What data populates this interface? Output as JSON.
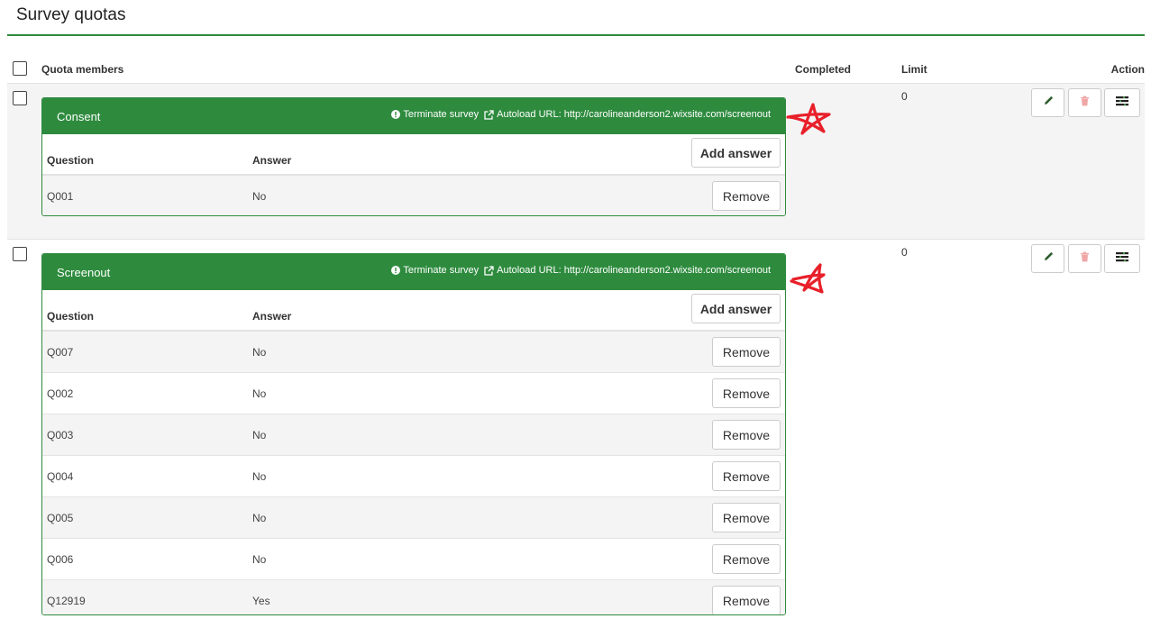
{
  "page": {
    "title": "Survey quotas"
  },
  "table_headers": {
    "members": "Quota members",
    "completed": "Completed",
    "limit": "Limit",
    "action": "Action"
  },
  "colors": {
    "accent": "#2e8b3e",
    "annotation": "#e8202a"
  },
  "icons": {
    "edit": "pencil-icon",
    "delete": "trash-icon",
    "details": "list-icon",
    "action": "exclamation-circle-icon",
    "link": "external-link-icon"
  },
  "quotas": [
    {
      "name": "Consent",
      "action_text": "Terminate survey",
      "autoload_text": "Autoload URL: http://carolineanderson2.wixsite.com/screenout",
      "limit": "0",
      "question_header": "Question",
      "answer_header": "Answer",
      "add_answer_label": "Add answer",
      "members": [
        {
          "question": "Q001",
          "answer": "No",
          "remove_label": "Remove"
        }
      ]
    },
    {
      "name": "Screenout",
      "action_text": "Terminate survey",
      "autoload_text": "Autoload URL: http://carolineanderson2.wixsite.com/screenout",
      "limit": "0",
      "question_header": "Question",
      "answer_header": "Answer",
      "add_answer_label": "Add answer",
      "members": [
        {
          "question": "Q007",
          "answer": "No",
          "remove_label": "Remove"
        },
        {
          "question": "Q002",
          "answer": "No",
          "remove_label": "Remove"
        },
        {
          "question": "Q003",
          "answer": "No",
          "remove_label": "Remove"
        },
        {
          "question": "Q004",
          "answer": "No",
          "remove_label": "Remove"
        },
        {
          "question": "Q005",
          "answer": "No",
          "remove_label": "Remove"
        },
        {
          "question": "Q006",
          "answer": "No",
          "remove_label": "Remove"
        },
        {
          "question": "Q12919",
          "answer": "Yes",
          "remove_label": "Remove"
        }
      ]
    }
  ]
}
